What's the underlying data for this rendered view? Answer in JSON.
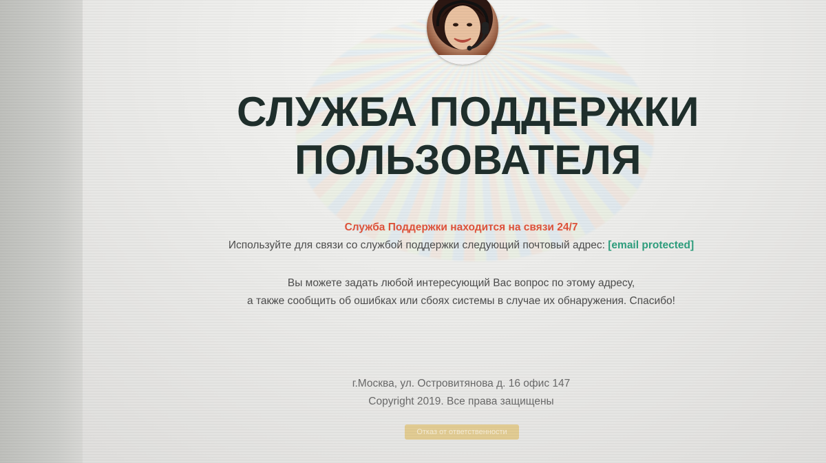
{
  "headline": {
    "line1": "СЛУЖБА ПОДДЕРЖКИ",
    "line2": "ПОЛЬЗОВАТЕЛЯ"
  },
  "info": {
    "notice": "Служба Поддержки находится на связи 24/7",
    "contact_text": "Используйте для связи со службой поддержки следующий почтовый адрес: ",
    "email": "[email protected]"
  },
  "message": {
    "line1": "Вы можете задать любой интересующий Вас вопрос по этому адресу,",
    "line2": "а также сообщить об ошибках или сбоях системы в случае их обнаружения. Спасибо!"
  },
  "footer": {
    "address": "г.Москва, ул. Островитянова д. 16 офис 147",
    "copyright": "Copyright 2019. Все права защищены"
  },
  "disclaimer_button": {
    "label": "Отказ от ответственности"
  },
  "colors": {
    "headline": "#1f2f2c",
    "notice": "#e0533b",
    "email": "#2d9e7d",
    "disclaimer_bg": "#e2cc93"
  },
  "icons": {
    "avatar": "support-operator-avatar"
  }
}
